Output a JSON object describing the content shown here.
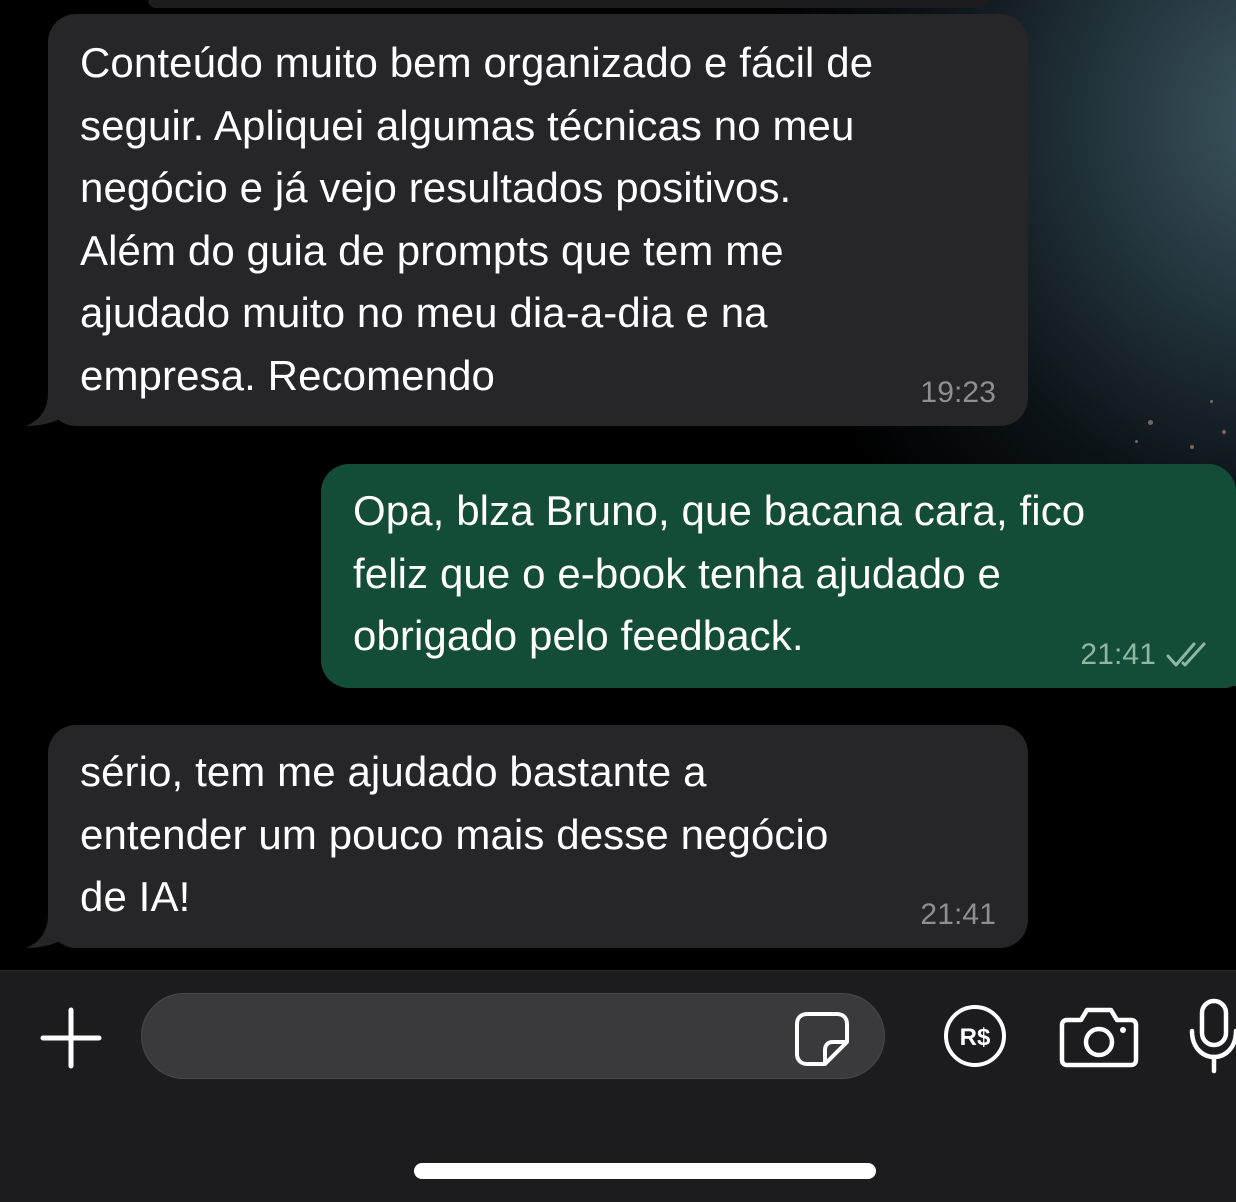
{
  "messages": [
    {
      "direction": "incoming",
      "text": "Conteúdo muito bem organizado e fácil de\nseguir. Apliquei algumas técnicas no meu\nnegócio e já vejo resultados positivos.\nAlém do guia de prompts que tem me\najudado muito no meu dia-a-dia e na\nempresa. Recomendo",
      "time": "19:23"
    },
    {
      "direction": "outgoing",
      "text": "Opa, blza Bruno, que bacana cara, fico\nfeliz que o e-book tenha ajudado e\nobrigado pelo feedback.",
      "time": "21:41",
      "status": "read"
    },
    {
      "direction": "incoming",
      "text": "sério, tem me ajudado bastante a\nentender um pouco mais desse negócio\nde IA!",
      "time": "21:41"
    }
  ],
  "composer": {
    "value": "",
    "pay_icon_label": "R$"
  },
  "colors": {
    "incoming_bubble": "#262628",
    "outgoing_bubble": "#144d37",
    "input_bar": "#1c1c1e",
    "text_field": "#3a3a3c"
  },
  "icons": {
    "attach": "plus-icon",
    "sticker": "sticker-icon",
    "payment": "brl-payment-icon",
    "camera": "camera-icon",
    "microphone": "microphone-icon",
    "read_receipt": "double-check-icon"
  }
}
